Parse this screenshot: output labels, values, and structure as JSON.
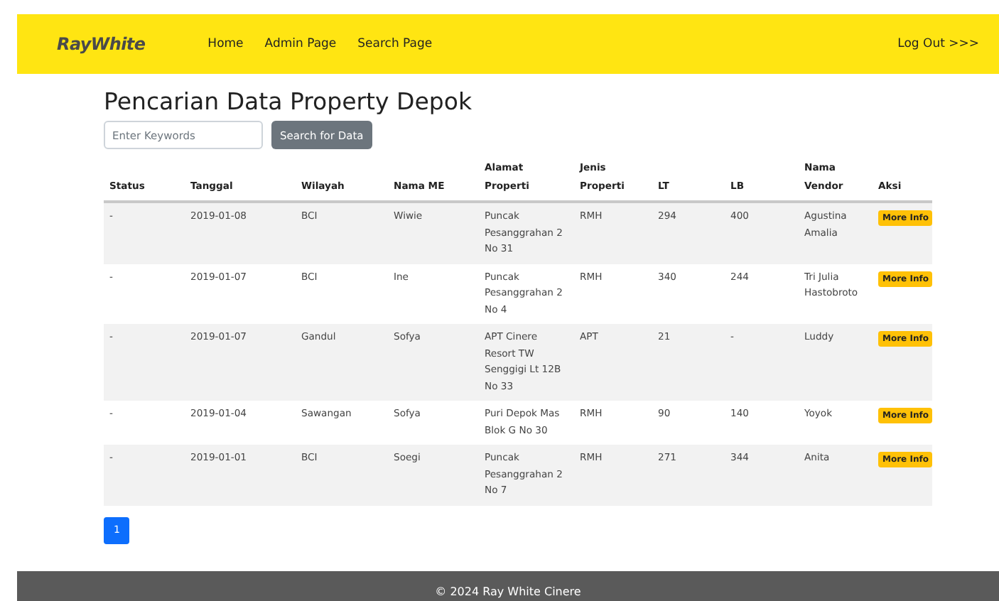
{
  "navbar": {
    "brand": "RayWhite",
    "links": [
      "Home",
      "Admin Page",
      "Search Page"
    ],
    "logout": "Log Out >>>"
  },
  "title": "Pencarian Data Property Depok",
  "search": {
    "placeholder": "Enter Keywords",
    "button": "Search for Data"
  },
  "table": {
    "columns": [
      "Status",
      "Tanggal",
      "Wilayah",
      "Nama ME",
      "Alamat Properti",
      "Jenis Properti",
      "LT",
      "LB",
      "Nama Vendor",
      "Aksi"
    ],
    "rows": [
      {
        "cells": [
          "-",
          "2019-01-08",
          "BCI",
          "Wiwie",
          "Puncak Pesanggrahan 2 No 31",
          "RMH",
          "294",
          "400",
          "Agustina Amalia"
        ],
        "action": "More Info"
      },
      {
        "cells": [
          "-",
          "2019-01-07",
          "BCI",
          "Ine",
          "Puncak Pesanggrahan 2 No 4",
          "RMH",
          "340",
          "244",
          "Tri Julia Hastobroto"
        ],
        "action": "More Info"
      },
      {
        "cells": [
          "-",
          "2019-01-07",
          "Gandul",
          "Sofya",
          "APT Cinere Resort TW Senggigi Lt 12B No 33",
          "APT",
          "21",
          "-",
          "Luddy"
        ],
        "action": "More Info"
      },
      {
        "cells": [
          "-",
          "2019-01-04",
          "Sawangan",
          "Sofya",
          "Puri Depok Mas Blok G No 30",
          "RMH",
          "90",
          "140",
          "Yoyok"
        ],
        "action": "More Info"
      },
      {
        "cells": [
          "-",
          "2019-01-01",
          "BCI",
          "Soegi",
          "Puncak Pesanggrahan 2 No 7",
          "RMH",
          "271",
          "344",
          "Anita"
        ],
        "action": "More Info"
      }
    ]
  },
  "pagination": [
    {
      "label": "1",
      "selected": true
    }
  ],
  "footer": "© 2024 Ray White Cinere"
}
